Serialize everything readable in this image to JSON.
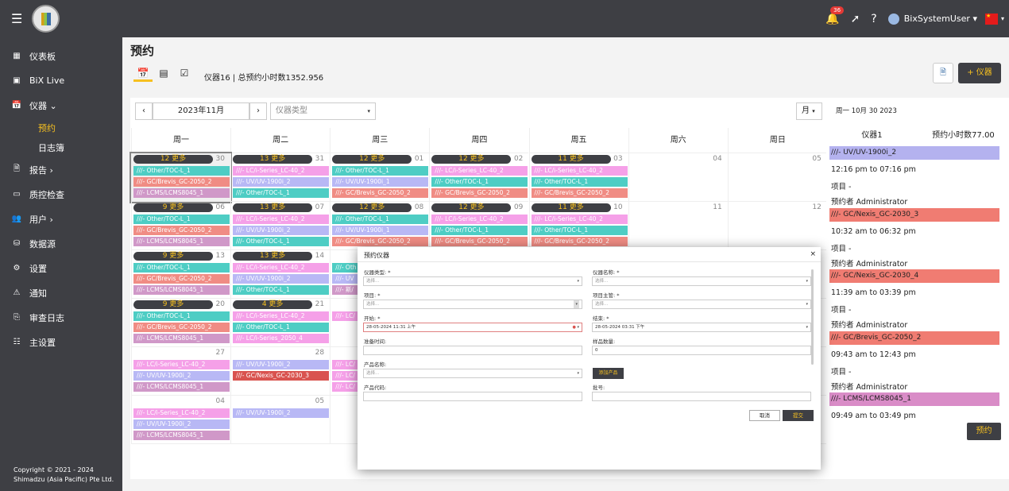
{
  "topbar": {
    "notif_count": "36",
    "username": "BixSystemUser"
  },
  "nav": [
    {
      "icon": "dashboard-icon",
      "label": "仪表板"
    },
    {
      "icon": "live-icon",
      "label": "BiX Live"
    },
    {
      "icon": "calendar-icon",
      "label": "仪器 ⌄"
    },
    {
      "icon": "",
      "label": "预约",
      "sub": true,
      "active": true
    },
    {
      "icon": "",
      "label": "日志簿",
      "sub": true
    },
    {
      "icon": "report-icon",
      "label": "报告 ›"
    },
    {
      "icon": "qc-icon",
      "label": "质控检查"
    },
    {
      "icon": "users-icon",
      "label": "用户 ›"
    },
    {
      "icon": "database-icon",
      "label": "数据源"
    },
    {
      "icon": "gear-icon",
      "label": "设置"
    },
    {
      "icon": "warning-icon",
      "label": "通知"
    },
    {
      "icon": "audit-icon",
      "label": "审查日志"
    },
    {
      "icon": "settings-list-icon",
      "label": "主设置"
    }
  ],
  "copyright": {
    "line1": "Copyright © 2021 - 2024",
    "line2": "Shimadzu (Asia Pacific) Pte Ltd."
  },
  "page": {
    "title": "预约",
    "summary": "仪器16 | 总预约小时数1352.956",
    "add_btn": "+ 仪器"
  },
  "calendar": {
    "month": "2023年11月",
    "type_placeholder": "仪器类型",
    "view": "月",
    "weekdays": [
      "周一",
      "周二",
      "周三",
      "周四",
      "周五",
      "周六",
      "周日"
    ],
    "weeks": [
      [
        {
          "d": "30",
          "more": "12 更多",
          "ev": [
            "///- Other/TOC-L_1",
            "///- GC/Brevis_GC-2050_2",
            "///- LCMS/LCMS8045_1"
          ],
          "sel": true
        },
        {
          "d": "31",
          "more": "13 更多",
          "ev": [
            "///- LC/i-Series_LC-40_2",
            "///- UV/UV-1900i_2",
            "///- Other/TOC-L_1"
          ]
        },
        {
          "d": "01",
          "more": "12 更多",
          "ev": [
            "///- Other/TOC-L_1",
            "///- UV/UV-1900i_1",
            "///- GC/Brevis_GC-2050_2"
          ]
        },
        {
          "d": "02",
          "more": "12 更多",
          "ev": [
            "///- LC/i-Series_LC-40_2",
            "///- Other/TOC-L_1",
            "///- GC/Brevis_GC-2050_2"
          ]
        },
        {
          "d": "03",
          "more": "11 更多",
          "ev": [
            "///- LC/i-Series_LC-40_2",
            "///- Other/TOC-L_1",
            "///- GC/Brevis_GC-2050_2"
          ]
        },
        {
          "d": "04",
          "ev": []
        },
        {
          "d": "05",
          "ev": []
        }
      ],
      [
        {
          "d": "06",
          "more": "9 更多",
          "ev": [
            "///- Other/TOC-L_1",
            "///- GC/Brevis_GC-2050_2",
            "///- LCMS/LCMS8045_1"
          ]
        },
        {
          "d": "07",
          "more": "13 更多",
          "ev": [
            "///- LC/i-Series_LC-40_2",
            "///- UV/UV-1900i_2",
            "///- Other/TOC-L_1"
          ]
        },
        {
          "d": "08",
          "more": "12 更多",
          "ev": [
            "///- Other/TOC-L_1",
            "///- UV/UV-1900i_1",
            "///- GC/Brevis_GC-2050_2"
          ]
        },
        {
          "d": "09",
          "more": "12 更多",
          "ev": [
            "///- LC/i-Series_LC-40_2",
            "///- Other/TOC-L_1",
            "///- GC/Brevis_GC-2050_2"
          ]
        },
        {
          "d": "10",
          "more": "11 更多",
          "ev": [
            "///- LC/i-Series_LC-40_2",
            "///- Other/TOC-L_1",
            "///- GC/Brevis_GC-2050_2"
          ]
        },
        {
          "d": "11",
          "ev": []
        },
        {
          "d": "12",
          "ev": []
        }
      ],
      [
        {
          "d": "13",
          "more": "9 更多",
          "ev": [
            "///- Other/TOC-L_1",
            "///- GC/Brevis_GC-2050_2",
            "///- LCMS/LCMS8045_1"
          ]
        },
        {
          "d": "14",
          "more": "13 更多",
          "ev": [
            "///- LC/i-Series_LC-40_2",
            "///- UV/UV-1900i_2",
            "///- Other/TOC-L_1"
          ]
        },
        {
          "d": "",
          "more": "",
          "ev": [
            "///- Oth",
            "///- UV",
            "///- 斯/"
          ]
        },
        {
          "d": "",
          "ev": []
        },
        {
          "d": "",
          "ev": []
        },
        {
          "d": "",
          "ev": []
        },
        {
          "d": "",
          "ev": []
        }
      ],
      [
        {
          "d": "20",
          "more": "9 更多",
          "ev": [
            "///- Other/TOC-L_1",
            "///- GC/Brevis_GC-2050_2",
            "///- LCMS/LCMS8045_1"
          ]
        },
        {
          "d": "21",
          "more": "4 更多",
          "ev": [
            "///- LC/i-Series_LC-40_2",
            "///- Other/TOC-L_1",
            "///- LC/i-Series_2050_4"
          ]
        },
        {
          "d": "",
          "ev": [
            "///- LC/"
          ]
        },
        {
          "d": "",
          "ev": []
        },
        {
          "d": "",
          "ev": []
        },
        {
          "d": "",
          "ev": []
        },
        {
          "d": "",
          "ev": []
        }
      ],
      [
        {
          "d": "27",
          "ev": [
            "///- LC/i-Series_LC-40_2",
            "///- UV/UV-1900i_2",
            "///- LCMS/LCMS8045_1"
          ]
        },
        {
          "d": "28",
          "ev": [
            "///- UV/UV-1900i_2",
            "///- GC/Nexis_GC-2030_3"
          ]
        },
        {
          "d": "",
          "ev": [
            "///- LC/",
            "///- LC/",
            "///- LC/"
          ]
        },
        {
          "d": "",
          "ev": []
        },
        {
          "d": "",
          "ev": []
        },
        {
          "d": "",
          "ev": []
        },
        {
          "d": "",
          "ev": []
        }
      ],
      [
        {
          "d": "04",
          "ev": [
            "///- LC/i-Series_LC-40_2",
            "///- UV/UV-1900i_2",
            "///- LCMS/LCMS8045_1"
          ]
        },
        {
          "d": "05",
          "ev": [
            "///- UV/UV-1900i_2"
          ]
        },
        {
          "d": "",
          "ev": []
        },
        {
          "d": "",
          "ev": []
        },
        {
          "d": "",
          "ev": []
        },
        {
          "d": "",
          "ev": []
        },
        {
          "d": "",
          "ev": []
        }
      ]
    ]
  },
  "right_panel": {
    "date": "周一 10月 30 2023",
    "instruments": "仪器1",
    "hours": "预约小时数77.00",
    "book_btn": "预约",
    "bookings": [
      {
        "head": "///- UV/UV-1900i_2",
        "color": "#b4b2ef",
        "time": "12:16 pm to 07:16 pm",
        "project": "项目 -",
        "by": "预约者 Administrator"
      },
      {
        "head": "///- GC/Nexis_GC-2030_3",
        "color": "#f07c72",
        "time": "10:32 am to 06:32 pm",
        "project": "项目 -",
        "by": "预约者 Administrator"
      },
      {
        "head": "///- GC/Nexis_GC-2030_4",
        "color": "#f07c72",
        "time": "11:39 am to 03:39 pm",
        "project": "项目 -",
        "by": "预约者 Administrator"
      },
      {
        "head": "///- GC/Brevis_GC-2050_2",
        "color": "#f07c72",
        "time": "09:43 am to 12:43 pm",
        "project": "项目 -",
        "by": "预约者 Administrator"
      },
      {
        "head": "///- LCMS/LCMS8045_1",
        "color": "#d98cc7",
        "time": "09:49 am to 03:49 pm",
        "project": "",
        "by": ""
      }
    ]
  },
  "modal": {
    "title": "预约仪器",
    "close": "×",
    "inst_type_lbl": "仪器类型: *",
    "inst_name_lbl": "仪器名称: *",
    "sel_ph": "选择...",
    "project_lbl": "项目: *",
    "project_owner_lbl": "项目主管: *",
    "start_lbl": "开始: *",
    "start_val": "28-05-2024 11:31 上午",
    "end_lbl": "结束: *",
    "end_val": "28-05-2024 03:31 下午",
    "prep_lbl": "准备时间:",
    "samples_lbl": "样品数量:",
    "samples_val": "0",
    "product_name_lbl": "产品名称:",
    "add_product": "添加产品",
    "product_code_lbl": "产品代码:",
    "batch_lbl": "批号:",
    "cancel": "取消",
    "submit": "提交"
  },
  "colors": {
    "sidebar": "#3e3f44",
    "accent": "#f6c020",
    "teal": "#4ecdc4",
    "pink": "#f5a0e8",
    "salmon": "#f08c84",
    "lavender": "#b8b8f5",
    "mauve": "#d098c8",
    "gray": "#b0b0b0",
    "red": "#d9534f"
  }
}
